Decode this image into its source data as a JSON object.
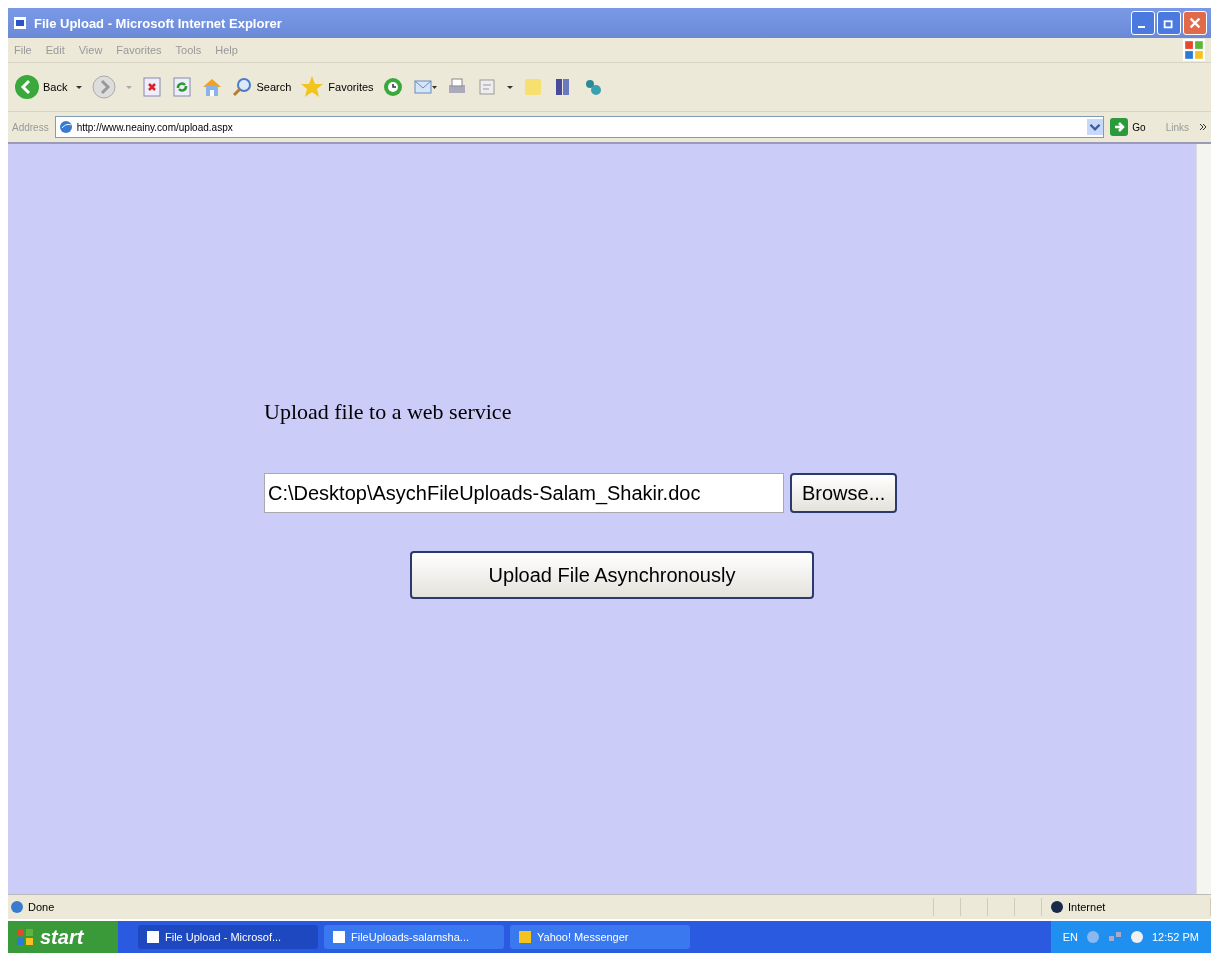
{
  "window": {
    "title": "File Upload - Microsoft Internet Explorer"
  },
  "menu": [
    "File",
    "Edit",
    "View",
    "Favorites",
    "Tools",
    "Help"
  ],
  "toolbar": {
    "back": "Back",
    "search": "Search",
    "favorites": "Favorites"
  },
  "address_bar": {
    "label": "Address",
    "url": "http://www.neainy.com/upload.aspx",
    "go": "Go",
    "links": "Links"
  },
  "page": {
    "heading": "Upload file to a web service",
    "file_field": {
      "value": "C:\\Desktop\\AsychFileUploads-Salam_Shakir.doc"
    },
    "browse": "Browse...",
    "upload": "Upload File Asynchronously"
  },
  "status_bar": {
    "text": "Done",
    "zone": "Internet"
  },
  "taskbar": {
    "start": "start",
    "tasks": [
      {
        "label": "File Upload - Microsof...",
        "selected": true
      },
      {
        "label": "FileUploads-salamsha...",
        "selected": false
      },
      {
        "label": "Yahoo! Messenger",
        "selected": false
      }
    ],
    "language": "EN",
    "clock": "12:52 PM"
  }
}
